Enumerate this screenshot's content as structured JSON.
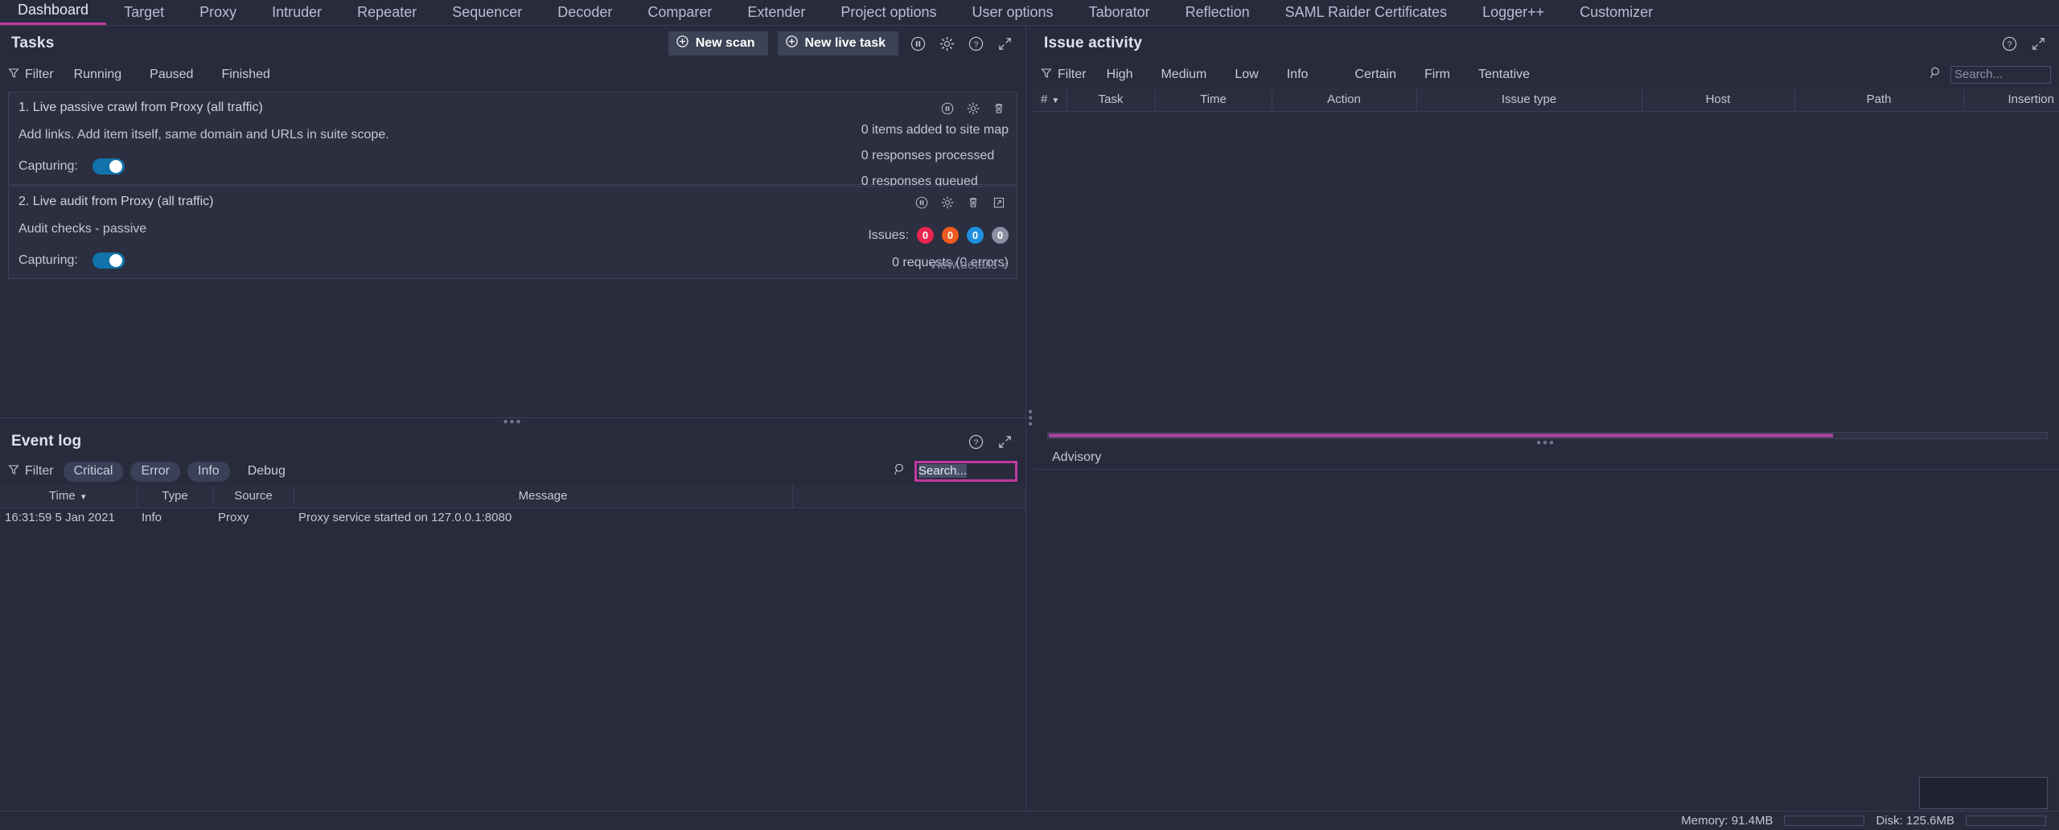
{
  "app": {
    "tabs": [
      {
        "label": "Dashboard",
        "active": true
      },
      {
        "label": "Target",
        "active": false
      },
      {
        "label": "Proxy",
        "active": false
      },
      {
        "label": "Intruder",
        "active": false
      },
      {
        "label": "Repeater",
        "active": false
      },
      {
        "label": "Sequencer",
        "active": false
      },
      {
        "label": "Decoder",
        "active": false
      },
      {
        "label": "Comparer",
        "active": false
      },
      {
        "label": "Extender",
        "active": false
      },
      {
        "label": "Project options",
        "active": false
      },
      {
        "label": "User options",
        "active": false
      },
      {
        "label": "Taborator",
        "active": false
      },
      {
        "label": "Reflection",
        "active": false
      },
      {
        "label": "SAML Raider Certificates",
        "active": false
      },
      {
        "label": "Logger++",
        "active": false
      },
      {
        "label": "Customizer",
        "active": false
      }
    ],
    "accent": "#c0399f"
  },
  "tasks_panel": {
    "title": "Tasks",
    "new_scan_label": "New scan",
    "new_live_task_label": "New live task",
    "filter_label": "Filter",
    "filter_chips": [
      {
        "label": "Running",
        "selected": false
      },
      {
        "label": "Paused",
        "selected": false
      },
      {
        "label": "Finished",
        "selected": false
      }
    ],
    "tasks": [
      {
        "title": "1. Live passive crawl from Proxy (all traffic)",
        "subtitle": "Add links. Add item itself, same domain and URLs in suite scope.",
        "capturing_label": "Capturing:",
        "capturing_on": true,
        "stats": [
          "0 items added to site map",
          "0 responses processed",
          "0 responses queued"
        ],
        "icons": [
          "pause-icon",
          "gear-icon",
          "trash-icon"
        ]
      },
      {
        "title": "2. Live audit from Proxy (all traffic)",
        "subtitle": "Audit checks - passive",
        "capturing_label": "Capturing:",
        "capturing_on": true,
        "issues_label": "Issues:",
        "issue_badges": [
          {
            "count": "0",
            "color": "#e8254f"
          },
          {
            "count": "0",
            "color": "#f0591f"
          },
          {
            "count": "0",
            "color": "#1f8fe0"
          },
          {
            "count": "0",
            "color": "#8a8fa3"
          }
        ],
        "requests_line": "0 requests (0 errors)",
        "view_details_label": "View details",
        "icons": [
          "pause-icon",
          "gear-icon",
          "trash-icon",
          "popout-icon"
        ]
      }
    ]
  },
  "event_log": {
    "title": "Event log",
    "filter_label": "Filter",
    "filter_chips": [
      {
        "label": "Critical",
        "selected": true
      },
      {
        "label": "Error",
        "selected": true
      },
      {
        "label": "Info",
        "selected": true
      },
      {
        "label": "Debug",
        "selected": false
      }
    ],
    "search": {
      "value": "Search...",
      "placeholder": "Search...",
      "focused": true
    },
    "columns": [
      "Time",
      "Type",
      "Source",
      "Message"
    ],
    "sort_column": "Time",
    "rows": [
      {
        "time": "16:31:59 5 Jan 2021",
        "type": "Info",
        "source": "Proxy",
        "message": "Proxy service started on 127.0.0.1:8080"
      }
    ]
  },
  "issue_activity": {
    "title": "Issue activity",
    "filter_label": "Filter",
    "severity_chips": [
      {
        "label": "High",
        "selected": false
      },
      {
        "label": "Medium",
        "selected": false
      },
      {
        "label": "Low",
        "selected": false
      },
      {
        "label": "Info",
        "selected": false
      }
    ],
    "confidence_chips": [
      {
        "label": "Certain",
        "selected": false
      },
      {
        "label": "Firm",
        "selected": false
      },
      {
        "label": "Tentative",
        "selected": false
      }
    ],
    "search": {
      "value": "",
      "placeholder": "Search...",
      "focused": false
    },
    "columns": [
      "#",
      "Task",
      "Time",
      "Action",
      "Issue type",
      "Host",
      "Path",
      "Insertion"
    ],
    "sort_column": "#",
    "rows": []
  },
  "advisory": {
    "tabs": [
      {
        "label": "Advisory",
        "active": true
      }
    ],
    "content": ""
  },
  "status_bar": {
    "memory_label": "Memory: 91.4MB",
    "disk_label": "Disk: 125.6MB"
  }
}
